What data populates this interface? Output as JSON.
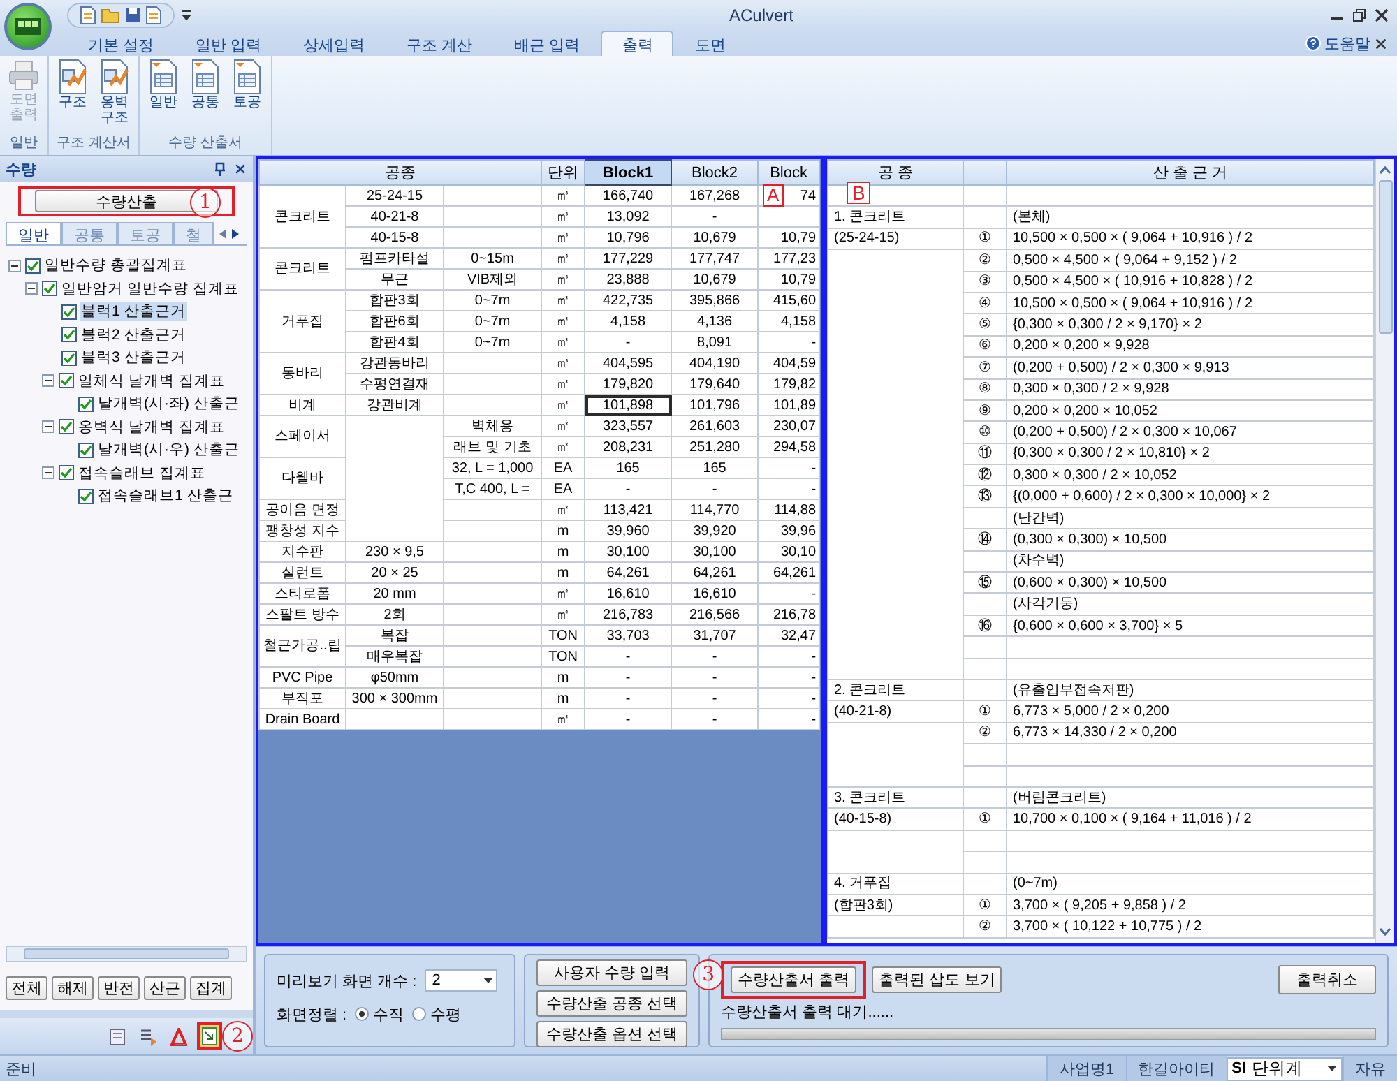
{
  "window": {
    "title": "ACulvert"
  },
  "ribbon_tabs": [
    {
      "label": "기본 설정",
      "selected": false
    },
    {
      "label": "일반 입력",
      "selected": false
    },
    {
      "label": "상세입력",
      "selected": false
    },
    {
      "label": "구조 계산",
      "selected": false
    },
    {
      "label": "배근 입력",
      "selected": false
    },
    {
      "label": "출력",
      "selected": true
    },
    {
      "label": "도면",
      "selected": false
    }
  ],
  "help": {
    "label": "도움말"
  },
  "ribbon_groups": [
    {
      "label": "일반",
      "buttons": [
        {
          "label": "도면\n출력",
          "kind": "printer",
          "disabled": true
        }
      ]
    },
    {
      "label": "구조 계산서",
      "buttons": [
        {
          "label": "구조",
          "kind": "calc",
          "disabled": false
        },
        {
          "label": "옹벽\n구조",
          "kind": "calc",
          "disabled": false
        }
      ]
    },
    {
      "label": "수량 산출서",
      "buttons": [
        {
          "label": "일반",
          "kind": "sheet",
          "disabled": false
        },
        {
          "label": "공통",
          "kind": "sheet",
          "disabled": false
        },
        {
          "label": "토공",
          "kind": "sheet",
          "disabled": false
        }
      ]
    }
  ],
  "side_panel": {
    "title": "수량",
    "action": {
      "label": "수량산출",
      "annotation": "1"
    },
    "tabs": [
      {
        "label": "일반",
        "selected": true
      },
      {
        "label": "공통",
        "selected": false
      },
      {
        "label": "토공",
        "selected": false
      },
      {
        "label": "철",
        "selected": false
      }
    ],
    "tree": [
      {
        "label": "일반수량 총괄집계표",
        "checked": true,
        "expanded": true,
        "selected": false,
        "children": [
          {
            "label": "일반암거 일반수량 집계표",
            "checked": true,
            "expanded": true,
            "selected": false,
            "children": [
              {
                "label": "블럭1 산출근거",
                "checked": true,
                "selected": true
              },
              {
                "label": "블럭2 산출근거",
                "checked": true,
                "selected": false
              },
              {
                "label": "블럭3 산출근거",
                "checked": true,
                "selected": false
              },
              {
                "label": "일체식 날개벽 집계표",
                "checked": true,
                "expanded": true,
                "selected": false,
                "children": [
                  {
                    "label": "날개벽(시·좌) 산출근",
                    "checked": true,
                    "selected": false
                  }
                ]
              },
              {
                "label": "옹벽식 날개벽 집계표",
                "checked": true,
                "expanded": true,
                "selected": false,
                "children": [
                  {
                    "label": "날개벽(시·우) 산출근",
                    "checked": true,
                    "selected": false
                  }
                ]
              },
              {
                "label": "접속슬래브 집계표",
                "checked": true,
                "expanded": true,
                "selected": false,
                "children": [
                  {
                    "label": "접속슬래브1 산출근",
                    "checked": true,
                    "selected": false
                  }
                ]
              }
            ]
          }
        ]
      }
    ],
    "buttons": [
      "전체",
      "해제",
      "반전",
      "산근",
      "집계"
    ],
    "tools": [
      {
        "selected": false
      },
      {
        "selected": false
      },
      {
        "selected": false
      },
      {
        "selected": true
      }
    ],
    "tools_annotation": "2"
  },
  "quantity_table": {
    "annotation": "A",
    "columns": [
      {
        "label": "공종",
        "selected": false
      },
      {
        "label": "단위",
        "selected": false
      },
      {
        "label": "Block1",
        "selected": true
      },
      {
        "label": "Block2",
        "selected": false
      },
      {
        "label": "Block",
        "selected": false
      }
    ],
    "groups": [
      {
        "label": "콘크리트",
        "rows": [
          {
            "sub": "25-24-15",
            "unit": "㎥",
            "values": [
              "166,740",
              "167,268",
              "74"
            ],
            "focused": false
          },
          {
            "sub": "40-21-8",
            "unit": "㎥",
            "values": [
              "13,092",
              "-"
            ],
            "focused": false
          },
          {
            "sub": "40-15-8",
            "unit": "㎥",
            "values": [
              "10,796",
              "10,679",
              "10,79"
            ],
            "focused": false
          }
        ]
      },
      {
        "label": "콘크리트",
        "rows": [
          {
            "sub": "펌프카타설",
            "spec": "0~15m",
            "unit": "㎥",
            "values": [
              "177,229",
              "177,747",
              "177,23"
            ],
            "focused": false
          },
          {
            "sub": "무근",
            "spec": "VIB제외",
            "unit": "㎥",
            "values": [
              "23,888",
              "10,679",
              "10,79"
            ],
            "focused": false
          }
        ]
      },
      {
        "label": "거푸집",
        "rows": [
          {
            "sub": "합판3회",
            "spec": "0~7m",
            "unit": "㎡",
            "values": [
              "422,735",
              "395,866",
              "415,60"
            ],
            "focused": false
          },
          {
            "sub": "합판6회",
            "spec": "0~7m",
            "unit": "㎡",
            "values": [
              "4,158",
              "4,136",
              "4,158"
            ],
            "focused": false
          },
          {
            "sub": "합판4회",
            "spec": "0~7m",
            "unit": "㎡",
            "values": [
              "-",
              "8,091",
              "-"
            ],
            "focused": false
          }
        ]
      },
      {
        "label": "동바리",
        "rows": [
          {
            "sub": "강관동바리",
            "unit": "㎥",
            "values": [
              "404,595",
              "404,190",
              "404,59"
            ],
            "focused": false
          },
          {
            "sub": "수평연결재",
            "unit": "㎡",
            "values": [
              "179,820",
              "179,640",
              "179,82"
            ],
            "focused": false
          }
        ]
      },
      {
        "label": "비계",
        "rows": [
          {
            "sub": "강관비계",
            "unit": "㎡",
            "values": [
              "101,898",
              "101,796",
              "101,89"
            ],
            "focused": true
          }
        ]
      },
      {
        "label": "스페이서",
        "rows": [
          {
            "spec": "벽체용",
            "unit": "㎡",
            "values": [
              "323,557",
              "261,603",
              "230,07"
            ],
            "focused": false
          },
          {
            "spec": "래브 및 기초",
            "unit": "㎡",
            "values": [
              "208,231",
              "251,280",
              "294,58"
            ],
            "focused": false
          }
        ]
      },
      {
        "label": "다웰바",
        "rows": [
          {
            "spec": "32, L = 1,000",
            "unit": "EA",
            "values": [
              "165",
              "165",
              "-"
            ],
            "focused": false
          },
          {
            "spec": "T,C 400, L =",
            "unit": "EA",
            "values": [
              "-",
              "-",
              "-"
            ],
            "focused": false
          }
        ]
      },
      {
        "label": "공이음 면정",
        "rows": [
          {
            "unit": "㎡",
            "values": [
              "113,421",
              "114,770",
              "114,88"
            ],
            "focused": false
          }
        ]
      },
      {
        "label": "팽창성 지수",
        "rows": [
          {
            "unit": "m",
            "values": [
              "39,960",
              "39,920",
              "39,96"
            ],
            "focused": false
          }
        ]
      },
      {
        "label": "지수판",
        "rows": [
          {
            "sub": "230 × 9,5",
            "unit": "m",
            "values": [
              "30,100",
              "30,100",
              "30,10"
            ],
            "focused": false
          }
        ]
      },
      {
        "label": "실런트",
        "rows": [
          {
            "sub": "20 × 25",
            "unit": "m",
            "values": [
              "64,261",
              "64,261",
              "64,261"
            ],
            "focused": false
          }
        ]
      },
      {
        "label": "스티로폼",
        "rows": [
          {
            "sub": "20 mm",
            "unit": "㎡",
            "values": [
              "16,610",
              "16,610",
              "-"
            ],
            "focused": false
          }
        ]
      },
      {
        "label": "스팔트 방수",
        "rows": [
          {
            "sub": "2회",
            "unit": "㎡",
            "values": [
              "216,783",
              "216,566",
              "216,78"
            ],
            "focused": false
          }
        ]
      },
      {
        "label": "철근가공..립",
        "rows": [
          {
            "sub": "복잡",
            "unit": "TON",
            "values": [
              "33,703",
              "31,707",
              "32,47"
            ],
            "focused": false
          },
          {
            "sub": "매우복잡",
            "unit": "TON",
            "values": [
              "-",
              "-",
              "-"
            ],
            "focused": false
          }
        ]
      },
      {
        "label": "PVC Pipe",
        "rows": [
          {
            "sub": "φ50mm",
            "unit": "m",
            "values": [
              "-",
              "-",
              "-"
            ],
            "focused": false
          }
        ]
      },
      {
        "label": "부직포",
        "rows": [
          {
            "sub": "300 × 300mm",
            "unit": "m",
            "values": [
              "-",
              "-",
              "-"
            ],
            "focused": false
          }
        ]
      },
      {
        "label": "Drain Board",
        "rows": [
          {
            "unit": "㎡",
            "values": [
              "-",
              "-",
              "-"
            ],
            "focused": false
          }
        ]
      }
    ]
  },
  "basis_table": {
    "annotation": "B",
    "columns": [
      "공 종",
      "산 출 근 거"
    ],
    "rows": [
      {},
      {
        "item": "1. 콘크리트",
        "basis": "(본체)"
      },
      {
        "item": "(25-24-15)",
        "num": "①",
        "basis": "10,500 × 0,500 × ( 9,064 + 10,916 ) / 2"
      },
      {
        "num": "②",
        "basis": "0,500 × 4,500 × ( 9,064 + 9,152 ) / 2"
      },
      {
        "num": "③",
        "basis": "0,500 × 4,500 × ( 10,916 + 10,828 ) / 2"
      },
      {
        "num": "④",
        "basis": "10,500 × 0,500 × ( 9,064 + 10,916 ) / 2"
      },
      {
        "num": "⑤",
        "basis": "{0,300 × 0,300 / 2 × 9,170} × 2"
      },
      {
        "num": "⑥",
        "basis": "0,200 × 0,200 × 9,928"
      },
      {
        "num": "⑦",
        "basis": "(0,200 + 0,500) / 2 × 0,300 × 9,913"
      },
      {
        "num": "⑧",
        "basis": "0,300 × 0,300 / 2 × 9,928"
      },
      {
        "num": "⑨",
        "basis": "0,200 × 0,200 × 10,052"
      },
      {
        "num": "⑩",
        "basis": "(0,200 + 0,500) / 2 × 0,300 × 10,067"
      },
      {
        "num": "⑪",
        "basis": "{0,300 × 0,300 / 2 × 10,810} × 2"
      },
      {
        "num": "⑫",
        "basis": "0,300 × 0,300 / 2 × 10,052"
      },
      {
        "num": "⑬",
        "basis": "{(0,000 + 0,600) / 2 × 0,300 × 10,000} × 2"
      },
      {
        "basis": "(난간벽)"
      },
      {
        "num": "⑭",
        "basis": "(0,300 × 0,300) × 10,500"
      },
      {
        "basis": "(차수벽)"
      },
      {
        "num": "⑮",
        "basis": "(0,600 × 0,300) × 10,500"
      },
      {
        "basis": "(사각기둥)"
      },
      {
        "num": "⑯",
        "basis": "{0,600 × 0,600 × 3,700} × 5"
      },
      {},
      {},
      {
        "item": "2. 콘크리트",
        "basis": "(유출입부접속저판)"
      },
      {
        "item": "(40-21-8)",
        "num": "①",
        "basis": "6,773 × 5,000 / 2 × 0,200"
      },
      {
        "num": "②",
        "basis": "6,773 × 14,330 / 2 × 0,200"
      },
      {},
      {},
      {
        "item": "3. 콘크리트",
        "basis": "(버림콘크리트)"
      },
      {
        "item": "(40-15-8)",
        "num": "①",
        "basis": "10,700 × 0,100 × ( 9,164 + 11,016 ) / 2"
      },
      {},
      {},
      {
        "item": "4. 거푸집",
        "basis": "(0~7m)"
      },
      {
        "item": "(합판3회)",
        "num": "①",
        "basis": "3,700 × ( 9,205 + 9,858 ) / 2"
      },
      {
        "num": "②",
        "basis": "3,700 × ( 10,122 + 10,775 ) / 2"
      }
    ]
  },
  "output_panel": {
    "preview_label": "미리보기 화면 개수 :",
    "preview_count": "2",
    "align_label": "화면정렬 :",
    "align_options": [
      {
        "label": "수직",
        "selected": true
      },
      {
        "label": "수평",
        "selected": false
      }
    ],
    "option_buttons": [
      "사용자 수량 입력",
      "수량산출 공종 선택",
      "수량산출 옵션 선택"
    ],
    "annotation": "3",
    "print_button": "수량산출서 출력",
    "view_button": "출력된 삽도 보기",
    "cancel_button": "출력취소",
    "status": "수량산출서 출력 대기......",
    "progress": {
      "level": 0
    }
  },
  "status_bar": {
    "message": "준비",
    "items": [
      "사업명1",
      "한길아이티"
    ],
    "unit_prefix": "SI",
    "unit": "단위계",
    "mode": "자유"
  }
}
